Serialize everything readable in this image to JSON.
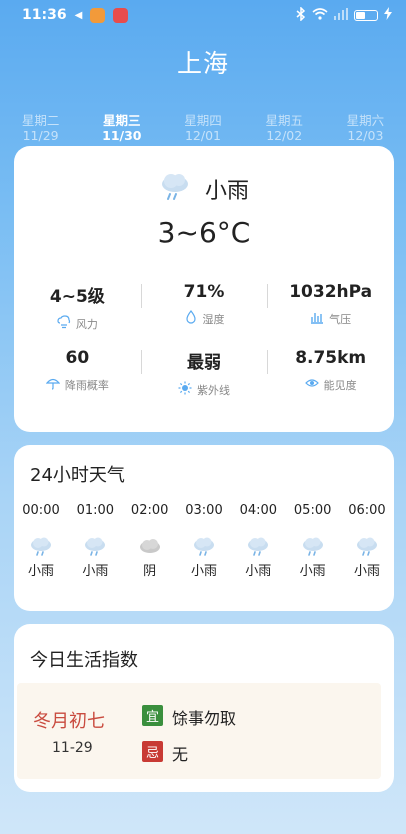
{
  "status_bar": {
    "time": "11:36",
    "battery_level": 0.45
  },
  "header": {
    "city": "上海"
  },
  "days": [
    {
      "weekday": "星期二",
      "date": "11/29",
      "active": false
    },
    {
      "weekday": "星期三",
      "date": "11/30",
      "active": true
    },
    {
      "weekday": "星期四",
      "date": "12/01",
      "active": false
    },
    {
      "weekday": "星期五",
      "date": "12/02",
      "active": false
    },
    {
      "weekday": "星期六",
      "date": "12/03",
      "active": false
    }
  ],
  "current": {
    "condition": "小雨",
    "temp_range": "3~6°C",
    "metrics": [
      {
        "value": "4~5级",
        "label": "风力",
        "icon": "wind-icon"
      },
      {
        "value": "71%",
        "label": "湿度",
        "icon": "humidity-icon"
      },
      {
        "value": "1032hPa",
        "label": "气压",
        "icon": "pressure-icon"
      },
      {
        "value": "60",
        "label": "降雨概率",
        "icon": "umbrella-icon"
      },
      {
        "value": "最弱",
        "label": "紫外线",
        "icon": "sun-icon"
      },
      {
        "value": "8.75km",
        "label": "能见度",
        "icon": "eye-icon"
      }
    ]
  },
  "hourly": {
    "title": "24小时天气",
    "items": [
      {
        "time": "00:00",
        "cond": "小雨",
        "icon": "rain-cloud-icon"
      },
      {
        "time": "01:00",
        "cond": "小雨",
        "icon": "rain-cloud-icon"
      },
      {
        "time": "02:00",
        "cond": "阴",
        "icon": "overcast-cloud-icon"
      },
      {
        "time": "03:00",
        "cond": "小雨",
        "icon": "rain-cloud-icon"
      },
      {
        "time": "04:00",
        "cond": "小雨",
        "icon": "rain-cloud-icon"
      },
      {
        "time": "05:00",
        "cond": "小雨",
        "icon": "rain-cloud-icon"
      },
      {
        "time": "06:00",
        "cond": "小雨",
        "icon": "rain-cloud-icon"
      }
    ]
  },
  "life": {
    "title": "今日生活指数",
    "lunar_date": "冬月初七",
    "solar_date": "11-29",
    "yi_tag": "宜",
    "yi_text": "馀事勿取",
    "ji_tag": "忌",
    "ji_text": "无"
  },
  "colors": {
    "accent_blue": "#5aaaf0",
    "lunar_red": "#c94b3f",
    "yi_green": "#3a8f3d",
    "ji_red": "#c83a34"
  }
}
